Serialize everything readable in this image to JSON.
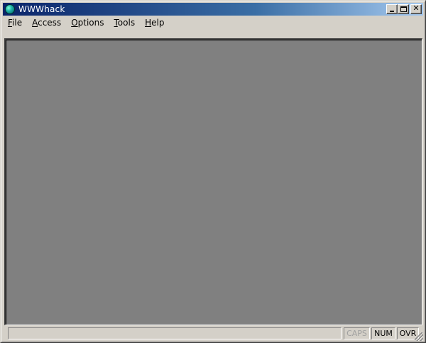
{
  "window": {
    "title": "WWWhack",
    "icon": "globe-icon"
  },
  "titlebar_buttons": {
    "minimize": "minimize-icon",
    "maximize": "maximize-icon",
    "close": "close-icon"
  },
  "menu": {
    "items": [
      {
        "label": "File",
        "underline": "F"
      },
      {
        "label": "Access",
        "underline": "A"
      },
      {
        "label": "Options",
        "underline": "O"
      },
      {
        "label": "Tools",
        "underline": "T"
      },
      {
        "label": "Help",
        "underline": "H"
      }
    ]
  },
  "statusbar": {
    "message": "",
    "caps": "CAPS",
    "num": "NUM",
    "ovr": "OVR"
  },
  "colors": {
    "client_background": "#808080",
    "titlebar_start": "#0a246a",
    "titlebar_end": "#a6caf0",
    "face": "#d4d0c8"
  }
}
